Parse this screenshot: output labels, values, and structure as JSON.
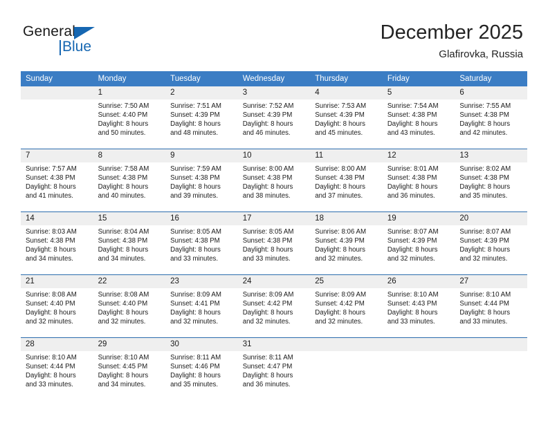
{
  "brand": {
    "name_part1": "General",
    "name_part2": "Blue",
    "logo_icon": "triangle-logo-icon",
    "accent_color": "#1667b2"
  },
  "header": {
    "title": "December 2025",
    "subtitle": "Glafirovka, Russia"
  },
  "theme": {
    "header_bar_color": "#3b7dc4",
    "daynum_strip_color": "#efefef",
    "row_border_color": "#2b6cad"
  },
  "weekday_headers": [
    "Sunday",
    "Monday",
    "Tuesday",
    "Wednesday",
    "Thursday",
    "Friday",
    "Saturday"
  ],
  "weeks": [
    [
      {
        "day": "",
        "sunrise": "",
        "sunset": "",
        "daylight_line1": "",
        "daylight_line2": "",
        "blank": true
      },
      {
        "day": "1",
        "sunrise": "Sunrise: 7:50 AM",
        "sunset": "Sunset: 4:40 PM",
        "daylight_line1": "Daylight: 8 hours",
        "daylight_line2": "and 50 minutes."
      },
      {
        "day": "2",
        "sunrise": "Sunrise: 7:51 AM",
        "sunset": "Sunset: 4:39 PM",
        "daylight_line1": "Daylight: 8 hours",
        "daylight_line2": "and 48 minutes."
      },
      {
        "day": "3",
        "sunrise": "Sunrise: 7:52 AM",
        "sunset": "Sunset: 4:39 PM",
        "daylight_line1": "Daylight: 8 hours",
        "daylight_line2": "and 46 minutes."
      },
      {
        "day": "4",
        "sunrise": "Sunrise: 7:53 AM",
        "sunset": "Sunset: 4:39 PM",
        "daylight_line1": "Daylight: 8 hours",
        "daylight_line2": "and 45 minutes."
      },
      {
        "day": "5",
        "sunrise": "Sunrise: 7:54 AM",
        "sunset": "Sunset: 4:38 PM",
        "daylight_line1": "Daylight: 8 hours",
        "daylight_line2": "and 43 minutes."
      },
      {
        "day": "6",
        "sunrise": "Sunrise: 7:55 AM",
        "sunset": "Sunset: 4:38 PM",
        "daylight_line1": "Daylight: 8 hours",
        "daylight_line2": "and 42 minutes."
      }
    ],
    [
      {
        "day": "7",
        "sunrise": "Sunrise: 7:57 AM",
        "sunset": "Sunset: 4:38 PM",
        "daylight_line1": "Daylight: 8 hours",
        "daylight_line2": "and 41 minutes."
      },
      {
        "day": "8",
        "sunrise": "Sunrise: 7:58 AM",
        "sunset": "Sunset: 4:38 PM",
        "daylight_line1": "Daylight: 8 hours",
        "daylight_line2": "and 40 minutes."
      },
      {
        "day": "9",
        "sunrise": "Sunrise: 7:59 AM",
        "sunset": "Sunset: 4:38 PM",
        "daylight_line1": "Daylight: 8 hours",
        "daylight_line2": "and 39 minutes."
      },
      {
        "day": "10",
        "sunrise": "Sunrise: 8:00 AM",
        "sunset": "Sunset: 4:38 PM",
        "daylight_line1": "Daylight: 8 hours",
        "daylight_line2": "and 38 minutes."
      },
      {
        "day": "11",
        "sunrise": "Sunrise: 8:00 AM",
        "sunset": "Sunset: 4:38 PM",
        "daylight_line1": "Daylight: 8 hours",
        "daylight_line2": "and 37 minutes."
      },
      {
        "day": "12",
        "sunrise": "Sunrise: 8:01 AM",
        "sunset": "Sunset: 4:38 PM",
        "daylight_line1": "Daylight: 8 hours",
        "daylight_line2": "and 36 minutes."
      },
      {
        "day": "13",
        "sunrise": "Sunrise: 8:02 AM",
        "sunset": "Sunset: 4:38 PM",
        "daylight_line1": "Daylight: 8 hours",
        "daylight_line2": "and 35 minutes."
      }
    ],
    [
      {
        "day": "14",
        "sunrise": "Sunrise: 8:03 AM",
        "sunset": "Sunset: 4:38 PM",
        "daylight_line1": "Daylight: 8 hours",
        "daylight_line2": "and 34 minutes."
      },
      {
        "day": "15",
        "sunrise": "Sunrise: 8:04 AM",
        "sunset": "Sunset: 4:38 PM",
        "daylight_line1": "Daylight: 8 hours",
        "daylight_line2": "and 34 minutes."
      },
      {
        "day": "16",
        "sunrise": "Sunrise: 8:05 AM",
        "sunset": "Sunset: 4:38 PM",
        "daylight_line1": "Daylight: 8 hours",
        "daylight_line2": "and 33 minutes."
      },
      {
        "day": "17",
        "sunrise": "Sunrise: 8:05 AM",
        "sunset": "Sunset: 4:38 PM",
        "daylight_line1": "Daylight: 8 hours",
        "daylight_line2": "and 33 minutes."
      },
      {
        "day": "18",
        "sunrise": "Sunrise: 8:06 AM",
        "sunset": "Sunset: 4:39 PM",
        "daylight_line1": "Daylight: 8 hours",
        "daylight_line2": "and 32 minutes."
      },
      {
        "day": "19",
        "sunrise": "Sunrise: 8:07 AM",
        "sunset": "Sunset: 4:39 PM",
        "daylight_line1": "Daylight: 8 hours",
        "daylight_line2": "and 32 minutes."
      },
      {
        "day": "20",
        "sunrise": "Sunrise: 8:07 AM",
        "sunset": "Sunset: 4:39 PM",
        "daylight_line1": "Daylight: 8 hours",
        "daylight_line2": "and 32 minutes."
      }
    ],
    [
      {
        "day": "21",
        "sunrise": "Sunrise: 8:08 AM",
        "sunset": "Sunset: 4:40 PM",
        "daylight_line1": "Daylight: 8 hours",
        "daylight_line2": "and 32 minutes."
      },
      {
        "day": "22",
        "sunrise": "Sunrise: 8:08 AM",
        "sunset": "Sunset: 4:40 PM",
        "daylight_line1": "Daylight: 8 hours",
        "daylight_line2": "and 32 minutes."
      },
      {
        "day": "23",
        "sunrise": "Sunrise: 8:09 AM",
        "sunset": "Sunset: 4:41 PM",
        "daylight_line1": "Daylight: 8 hours",
        "daylight_line2": "and 32 minutes."
      },
      {
        "day": "24",
        "sunrise": "Sunrise: 8:09 AM",
        "sunset": "Sunset: 4:42 PM",
        "daylight_line1": "Daylight: 8 hours",
        "daylight_line2": "and 32 minutes."
      },
      {
        "day": "25",
        "sunrise": "Sunrise: 8:09 AM",
        "sunset": "Sunset: 4:42 PM",
        "daylight_line1": "Daylight: 8 hours",
        "daylight_line2": "and 32 minutes."
      },
      {
        "day": "26",
        "sunrise": "Sunrise: 8:10 AM",
        "sunset": "Sunset: 4:43 PM",
        "daylight_line1": "Daylight: 8 hours",
        "daylight_line2": "and 33 minutes."
      },
      {
        "day": "27",
        "sunrise": "Sunrise: 8:10 AM",
        "sunset": "Sunset: 4:44 PM",
        "daylight_line1": "Daylight: 8 hours",
        "daylight_line2": "and 33 minutes."
      }
    ],
    [
      {
        "day": "28",
        "sunrise": "Sunrise: 8:10 AM",
        "sunset": "Sunset: 4:44 PM",
        "daylight_line1": "Daylight: 8 hours",
        "daylight_line2": "and 33 minutes."
      },
      {
        "day": "29",
        "sunrise": "Sunrise: 8:10 AM",
        "sunset": "Sunset: 4:45 PM",
        "daylight_line1": "Daylight: 8 hours",
        "daylight_line2": "and 34 minutes."
      },
      {
        "day": "30",
        "sunrise": "Sunrise: 8:11 AM",
        "sunset": "Sunset: 4:46 PM",
        "daylight_line1": "Daylight: 8 hours",
        "daylight_line2": "and 35 minutes."
      },
      {
        "day": "31",
        "sunrise": "Sunrise: 8:11 AM",
        "sunset": "Sunset: 4:47 PM",
        "daylight_line1": "Daylight: 8 hours",
        "daylight_line2": "and 36 minutes."
      },
      {
        "day": "",
        "sunrise": "",
        "sunset": "",
        "daylight_line1": "",
        "daylight_line2": "",
        "blank": true
      },
      {
        "day": "",
        "sunrise": "",
        "sunset": "",
        "daylight_line1": "",
        "daylight_line2": "",
        "blank": true
      },
      {
        "day": "",
        "sunrise": "",
        "sunset": "",
        "daylight_line1": "",
        "daylight_line2": "",
        "blank": true
      }
    ]
  ]
}
